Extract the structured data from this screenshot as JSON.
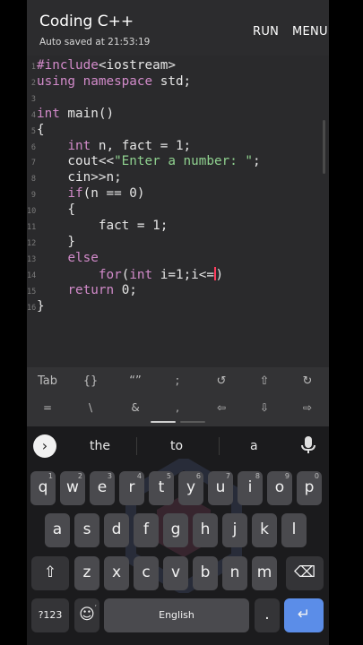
{
  "header": {
    "title": "Coding C++",
    "subtitle": "Auto saved at 21:53:19",
    "run_label": "RUN",
    "menu_label": "MENU"
  },
  "editor": {
    "line_numbers": [
      "1",
      "2",
      "3",
      "4",
      "5",
      "6",
      "7",
      "8",
      "9",
      "10",
      "11",
      "12",
      "13",
      "14",
      "15",
      "16"
    ],
    "lines": [
      [
        {
          "t": "#include",
          "c": "pp"
        },
        {
          "t": "<iostream>",
          "c": "pl"
        }
      ],
      [
        {
          "t": "using namespace",
          "c": "kw"
        },
        {
          "t": " std;",
          "c": "pl"
        }
      ],
      [],
      [
        {
          "t": "int",
          "c": "kw"
        },
        {
          "t": " main()",
          "c": "pl"
        }
      ],
      [
        {
          "t": "{",
          "c": "pl"
        }
      ],
      [
        {
          "t": "    ",
          "c": "pl"
        },
        {
          "t": "int",
          "c": "kw"
        },
        {
          "t": " n, fact = 1;",
          "c": "pl"
        }
      ],
      [
        {
          "t": "    cout<<",
          "c": "pl"
        },
        {
          "t": "\"Enter a number: \"",
          "c": "str"
        },
        {
          "t": ";",
          "c": "pl"
        }
      ],
      [
        {
          "t": "    cin>>n;",
          "c": "pl"
        }
      ],
      [
        {
          "t": "    ",
          "c": "pl"
        },
        {
          "t": "if",
          "c": "kw"
        },
        {
          "t": "(n == 0)",
          "c": "pl"
        }
      ],
      [
        {
          "t": "    {",
          "c": "pl"
        }
      ],
      [
        {
          "t": "        fact = 1;",
          "c": "pl"
        }
      ],
      [
        {
          "t": "    }",
          "c": "pl"
        }
      ],
      [
        {
          "t": "    ",
          "c": "pl"
        },
        {
          "t": "else",
          "c": "kw"
        }
      ],
      [
        {
          "t": "        ",
          "c": "pl"
        },
        {
          "t": "for",
          "c": "kw"
        },
        {
          "t": "(",
          "c": "pl"
        },
        {
          "t": "int",
          "c": "kw"
        },
        {
          "t": " i=1;i<=",
          "c": "pl"
        },
        {
          "t": "",
          "c": "cursor"
        },
        {
          "t": ")",
          "c": "pl"
        }
      ],
      [
        {
          "t": "    ",
          "c": "pl"
        },
        {
          "t": "return",
          "c": "kw"
        },
        {
          "t": " 0;",
          "c": "pl"
        }
      ],
      [
        {
          "t": "}",
          "c": "pl"
        }
      ]
    ]
  },
  "symbol_bar": {
    "row1": [
      "Tab",
      "{}",
      "“”",
      ";",
      "↺",
      "⇧",
      "↻"
    ],
    "row2": [
      "=",
      "\\",
      "&",
      ",",
      "⇦",
      "⇩",
      "⇨"
    ]
  },
  "keyboard": {
    "suggestions": [
      "the",
      "to",
      "a"
    ],
    "row1": [
      {
        "k": "q",
        "h": "1"
      },
      {
        "k": "w",
        "h": "2"
      },
      {
        "k": "e",
        "h": "3"
      },
      {
        "k": "r",
        "h": "4"
      },
      {
        "k": "t",
        "h": "5"
      },
      {
        "k": "y",
        "h": "6"
      },
      {
        "k": "u",
        "h": "7"
      },
      {
        "k": "i",
        "h": "8"
      },
      {
        "k": "o",
        "h": "9"
      },
      {
        "k": "p",
        "h": "0"
      }
    ],
    "row2": [
      "a",
      "s",
      "d",
      "f",
      "g",
      "h",
      "j",
      "k",
      "l"
    ],
    "row3": [
      "z",
      "x",
      "c",
      "v",
      "b",
      "n",
      "m"
    ],
    "shift_icon": "⇧",
    "backspace_icon": "⌫",
    "symbols_label": "?123",
    "comma_label": ",",
    "emoji_icon": "☺",
    "space_label": "English",
    "period_label": ".",
    "enter_icon": "↵"
  },
  "colors": {
    "keyword": "#d18ac9",
    "string": "#8fd18f",
    "cursor": "#ff3b5c",
    "enter_key": "#5b8de8"
  }
}
